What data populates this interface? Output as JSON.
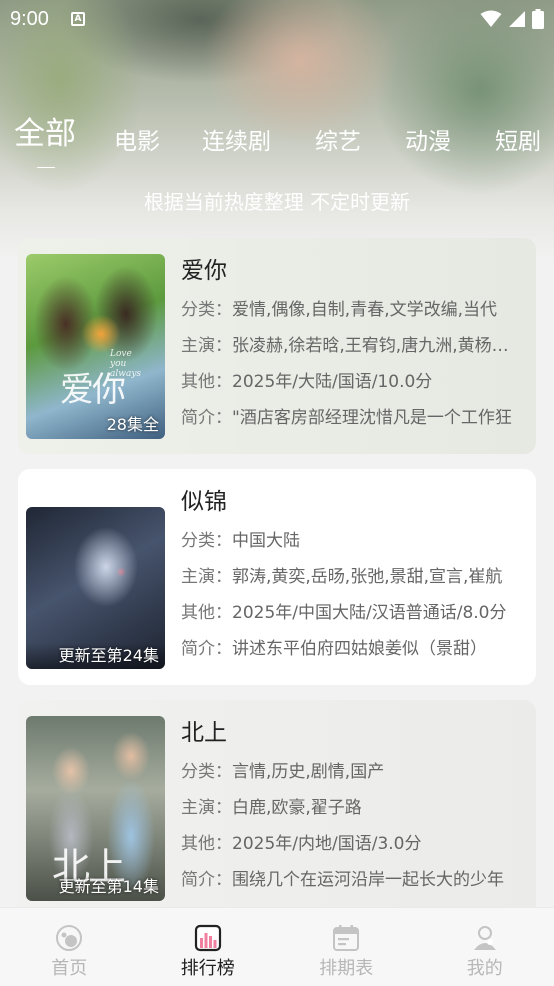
{
  "status_bar": {
    "time": "9:00",
    "notification_icon": "A"
  },
  "tabs": [
    "全部",
    "电影",
    "连续剧",
    "综艺",
    "动漫",
    "短剧"
  ],
  "active_tab": "全部",
  "subtitle": "根据当前热度整理 不定时更新",
  "labels": {
    "category": "分类：",
    "cast": "主演：",
    "other": "其他：",
    "intro": "简介："
  },
  "items": [
    {
      "title": "爱你",
      "category": "爱情,偶像,自制,青春,文学改编,当代",
      "cast": "张凌赫,徐若晗,王宥钧,唐九洲,黄杨钿甜",
      "other": "2025年/大陆/国语/10.0分",
      "intro": "\"酒店客房部经理沈惜凡是一个工作狂",
      "badge": "28集全",
      "poster_text": "爱你",
      "poster_sub": "Love you always"
    },
    {
      "title": "似锦",
      "category": "中国大陆",
      "cast": "郭涛,黄奕,岳旸,张弛,景甜,宣言,崔航",
      "other": "2025年/中国大陆/汉语普通话/8.0分",
      "intro": "讲述东平伯府四姑娘姜似（景甜）",
      "badge": "更新至第24集"
    },
    {
      "title": "北上",
      "category": "言情,历史,剧情,国产",
      "cast": "白鹿,欧豪,翟子路",
      "other": "2025年/内地/国语/3.0分",
      "intro": "围绕几个在运河沿岸一起长大的少年",
      "badge": "更新至第14集",
      "poster_text": "北上"
    }
  ],
  "bottom_nav": [
    {
      "label": "首页",
      "icon": "home-icon"
    },
    {
      "label": "排行榜",
      "icon": "ranking-icon",
      "active": true
    },
    {
      "label": "排期表",
      "icon": "calendar-icon"
    },
    {
      "label": "我的",
      "icon": "profile-icon"
    }
  ],
  "colors": {
    "active_text": "#222222",
    "inactive_nav": "#b7b7b7",
    "card_bg": "#ffffff"
  }
}
